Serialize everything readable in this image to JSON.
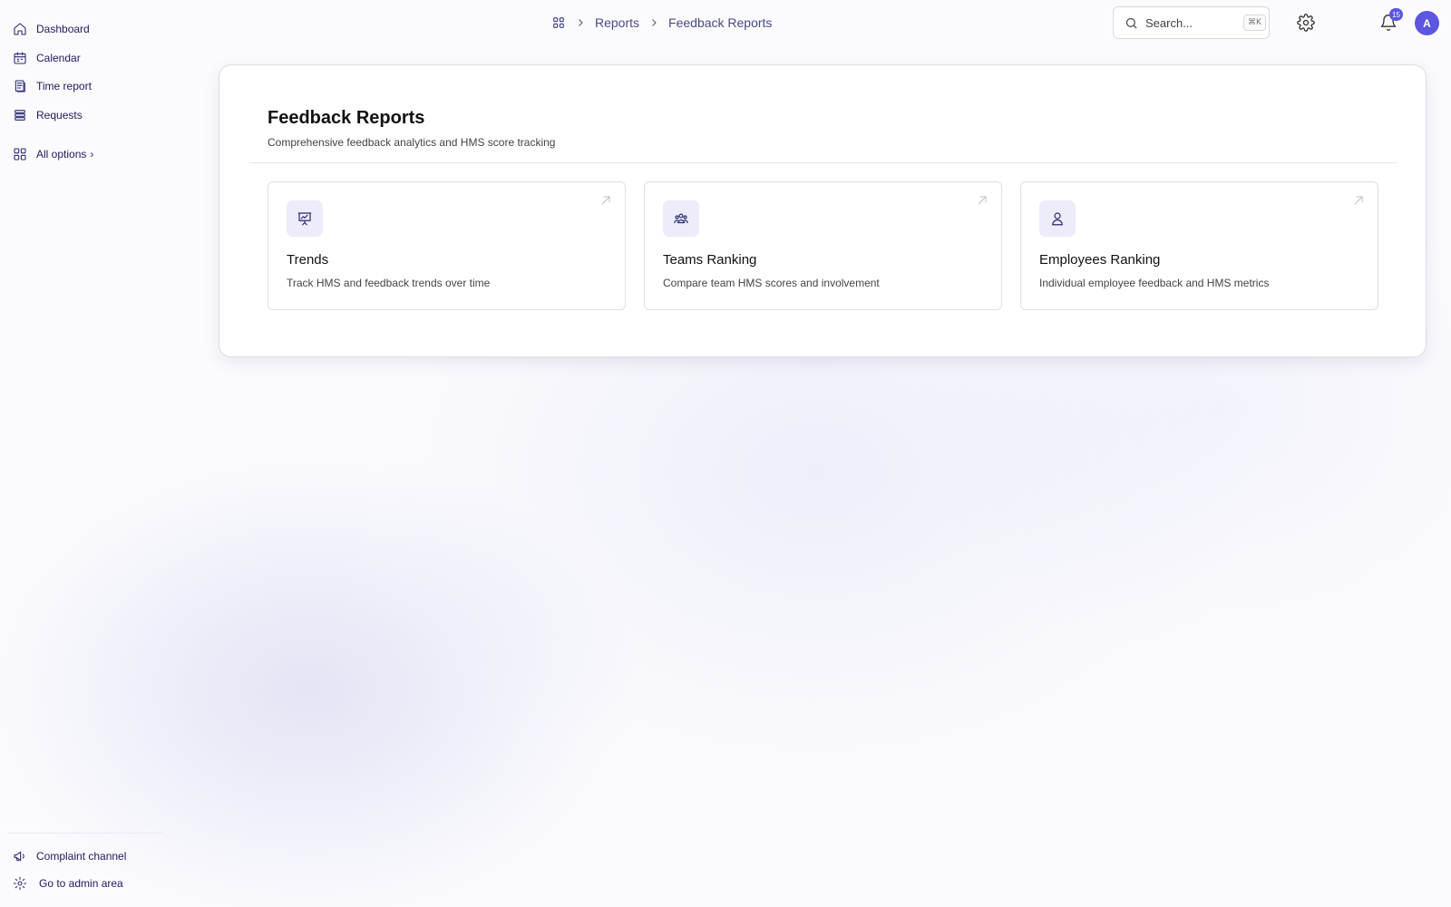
{
  "sidebar": {
    "items": [
      {
        "label": "Dashboard",
        "icon": "home-icon"
      },
      {
        "label": "Calendar",
        "icon": "calendar-icon"
      },
      {
        "label": "Time report",
        "icon": "report-icon"
      },
      {
        "label": "Requests",
        "icon": "list-icon"
      },
      {
        "label": "All options",
        "icon": "grid-icon"
      }
    ],
    "bottom": [
      {
        "label": "Complaint channel",
        "icon": "megaphone-icon"
      },
      {
        "label": "Go to admin area",
        "icon": "gear-icon"
      }
    ]
  },
  "breadcrumb": {
    "items": [
      "Reports",
      "Feedback Reports"
    ]
  },
  "search": {
    "placeholder": "Search...",
    "shortcut": "⌘K"
  },
  "notifications": {
    "count": "15"
  },
  "user": {
    "initial": "A"
  },
  "page": {
    "title": "Feedback Reports",
    "subtitle": "Comprehensive feedback analytics and HMS score tracking"
  },
  "cards": [
    {
      "title": "Trends",
      "description": "Track HMS and feedback trends over time",
      "icon": "presentation-chart-icon"
    },
    {
      "title": "Teams Ranking",
      "description": "Compare team HMS scores and involvement",
      "icon": "team-icon"
    },
    {
      "title": "Employees Ranking",
      "description": "Individual employee feedback and HMS metrics",
      "icon": "user-icon"
    }
  ],
  "colors": {
    "accent": "#5b57e0",
    "nav_text": "#1e1b5c",
    "icon_bg": "#ececfa"
  }
}
